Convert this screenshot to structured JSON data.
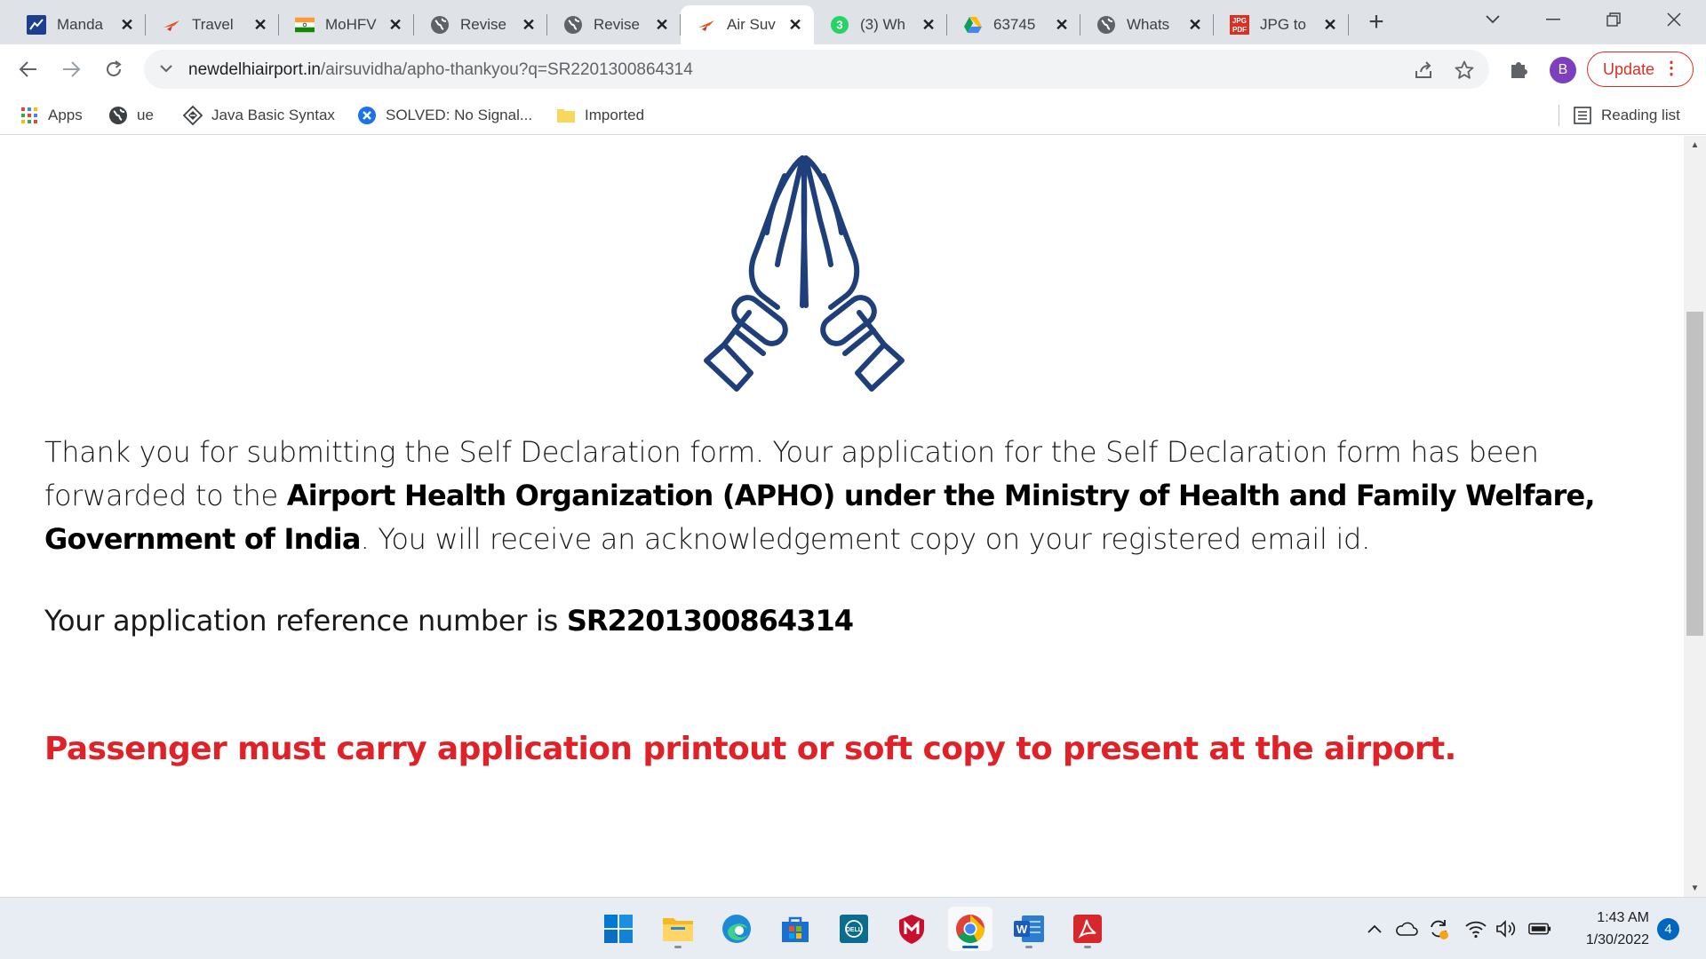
{
  "browser": {
    "tabs": [
      {
        "title": "Manda",
        "favicon": "mandate-icon"
      },
      {
        "title": "Travel",
        "favicon": "airsuvidha-icon"
      },
      {
        "title": "MoHFV",
        "favicon": "india-flag-icon"
      },
      {
        "title": "Revise",
        "favicon": "globe-icon"
      },
      {
        "title": "Revise",
        "favicon": "globe-icon"
      },
      {
        "title": "Air Suv",
        "favicon": "airsuvidha-icon",
        "active": true
      },
      {
        "title": "(3) Wh",
        "favicon": "whatsapp-icon",
        "badge": "3"
      },
      {
        "title": "63745",
        "favicon": "google-drive-icon"
      },
      {
        "title": "Whats",
        "favicon": "globe-icon"
      },
      {
        "title": "JPG to",
        "favicon": "jpg-pdf-icon",
        "badge": "JPG PDF"
      }
    ],
    "url_host": "newdelhiairport.in",
    "url_path": "/airsuvidha/apho-thankyou?q=SR2201300864314",
    "update_label": "Update",
    "profile_initial": "B",
    "bookmarks": [
      {
        "label": "Apps",
        "icon": "apps-grid-icon"
      },
      {
        "label": "ue",
        "icon": "globe-icon"
      },
      {
        "label": "Java Basic Syntax",
        "icon": "java-icon"
      },
      {
        "label": "SOLVED: No Signal...",
        "icon": "solved-icon"
      },
      {
        "label": "Imported",
        "icon": "folder-icon"
      }
    ],
    "reading_list": "Reading list"
  },
  "page": {
    "para_part1": "Thank you for submitting the Self Declaration form. Your application for the Self Declaration form has been forwarded to the ",
    "para_bold": "Airport Health Organization (APHO) under the Ministry of Health and Family Welfare, Government of India",
    "para_part2": ". You will receive an acknowledgement copy on your registered email id.",
    "ref_label": "Your application reference number is ",
    "ref_number": "SR2201300864314",
    "warning": "Passenger must carry application printout or soft copy to present at the airport."
  },
  "taskbar": {
    "time": "1:43 AM",
    "date": "1/30/2022",
    "notifications": "4",
    "colors": {
      "accent": "#0067c0",
      "warning_red": "#e02228",
      "icon_navy": "#1f3f7a"
    }
  }
}
